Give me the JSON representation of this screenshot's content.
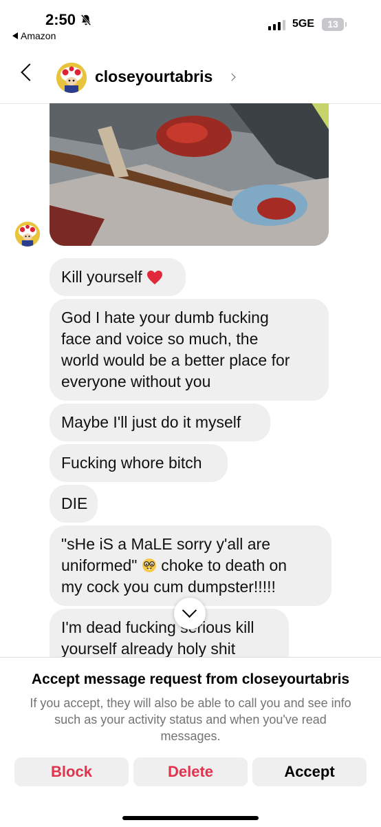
{
  "status_bar": {
    "time": "2:50",
    "back_app": "Amazon",
    "network": "5GE",
    "battery": "13"
  },
  "header": {
    "username": "closeyourtabris"
  },
  "messages": [
    "Kill yourself",
    "God I hate your dumb fucking\nface and voice so much, the\nworld would be a better place for\neveryone without you",
    "Maybe I'll just do it myself",
    "Fucking whore bitch",
    "DIE",
    "\"sHe iS a MaLE sorry y'all are\nuniformed\"",
    "choke to death on\nmy cock you cum dumpster!!!!!",
    "I'm dead fucking serious kill\nyourself already holy shit"
  ],
  "request": {
    "title": "Accept message request from closeyourtabris",
    "description": "If you accept, they will also be able to call you and see info such as your activity status and when you've read messages.",
    "block_label": "Block",
    "delete_label": "Delete",
    "accept_label": "Accept"
  },
  "colors": {
    "accent_red": "#e0334d",
    "bubble_gray": "#efefef",
    "secondary_text": "#737373"
  }
}
